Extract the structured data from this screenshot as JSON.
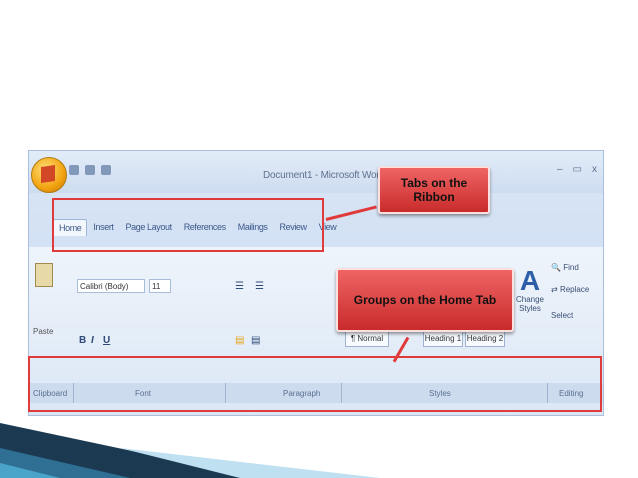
{
  "window": {
    "title": "Document1 - Microsoft Word",
    "controls": [
      "–",
      "▭",
      "x"
    ]
  },
  "tabs": [
    "Home",
    "Insert",
    "Page Layout",
    "References",
    "Mailings",
    "Review",
    "View"
  ],
  "callouts": {
    "tabs": "Tabs on the Ribbon",
    "groups": "Groups on the Home Tab"
  },
  "home": {
    "paste_label": "Paste",
    "font_name": "Calibri (Body)",
    "font_size": "11",
    "style_normal": "¶ Normal",
    "style_heading1": "Heading 1",
    "style_heading2": "Heading 2",
    "change_styles": "Change Styles",
    "find": "Find",
    "replace": "Replace",
    "select": "Select"
  },
  "groups": [
    "Clipboard",
    "Font",
    "Paragraph",
    "Styles",
    "Editing"
  ],
  "icons": [
    "office-button-icon",
    "save-icon",
    "undo-icon",
    "redo-icon",
    "paste-icon",
    "bold-icon",
    "italic-icon",
    "underline-icon",
    "align-left-icon",
    "change-styles-icon",
    "find-icon",
    "replace-icon"
  ],
  "colors": {
    "callout_red": "#e03a3a",
    "ribbon_blue": "#d9e6f6",
    "deco_dark": "#1b3a52",
    "deco_light": "#4aa3c8"
  }
}
